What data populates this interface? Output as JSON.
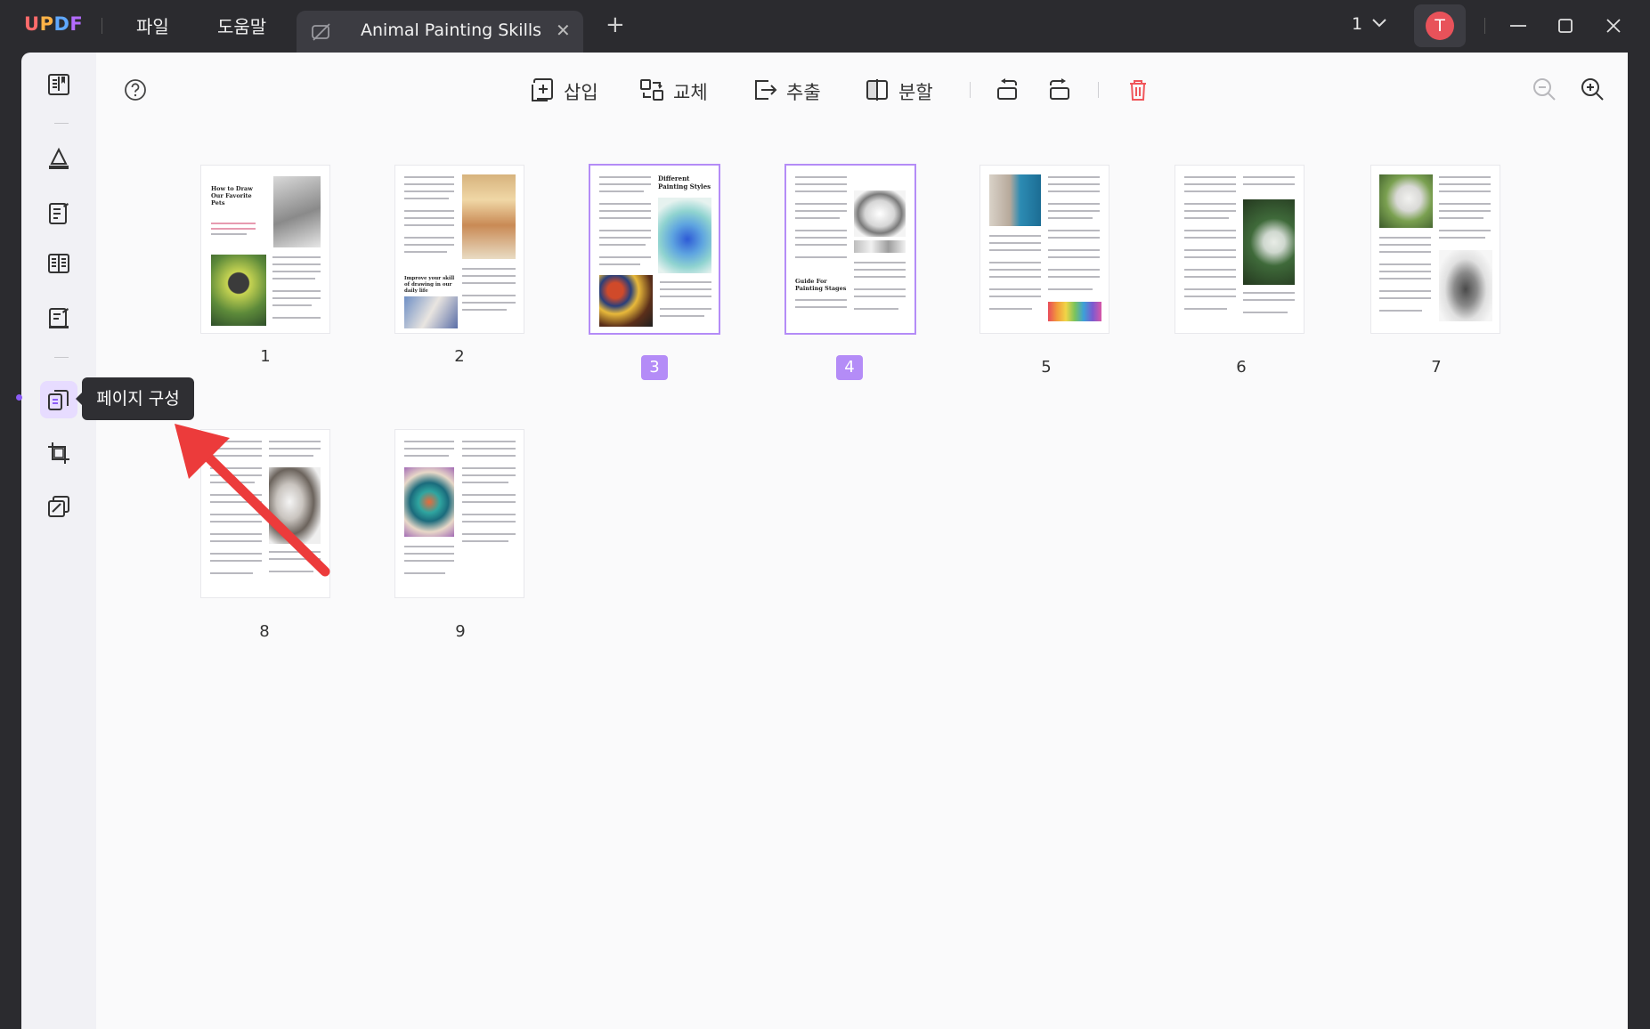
{
  "app": {
    "logo": "UPDF"
  },
  "menu": {
    "file": "파일",
    "help": "도움말"
  },
  "tab": {
    "title": "Animal Painting Skills",
    "close": "✕",
    "new_tab": "+"
  },
  "page_indicator": {
    "current": "1"
  },
  "user": {
    "avatar_letter": "T"
  },
  "tooltip": {
    "text": "페이지 구성"
  },
  "toolbar": {
    "insert": "삽입",
    "replace": "교체",
    "extract": "추출",
    "split": "분할"
  },
  "pages": [
    {
      "label": "1",
      "selected": false
    },
    {
      "label": "2",
      "selected": false
    },
    {
      "label": "3",
      "selected": true
    },
    {
      "label": "4",
      "selected": true
    },
    {
      "label": "5",
      "selected": false
    },
    {
      "label": "6",
      "selected": false
    },
    {
      "label": "7",
      "selected": false
    },
    {
      "label": "8",
      "selected": false
    },
    {
      "label": "9",
      "selected": false
    }
  ],
  "thumb_text": {
    "p1_heading": "How to Draw Our Favorite Pets",
    "p2_heading": "Improve your skill of drawing in our daily life",
    "p3_heading": "Different Painting Styles",
    "p4_heading": "Guide For Painting Stages"
  },
  "colors": {
    "accent": "#b48cf7",
    "delete": "#f0555a",
    "titlebar": "#2b2b2f"
  }
}
